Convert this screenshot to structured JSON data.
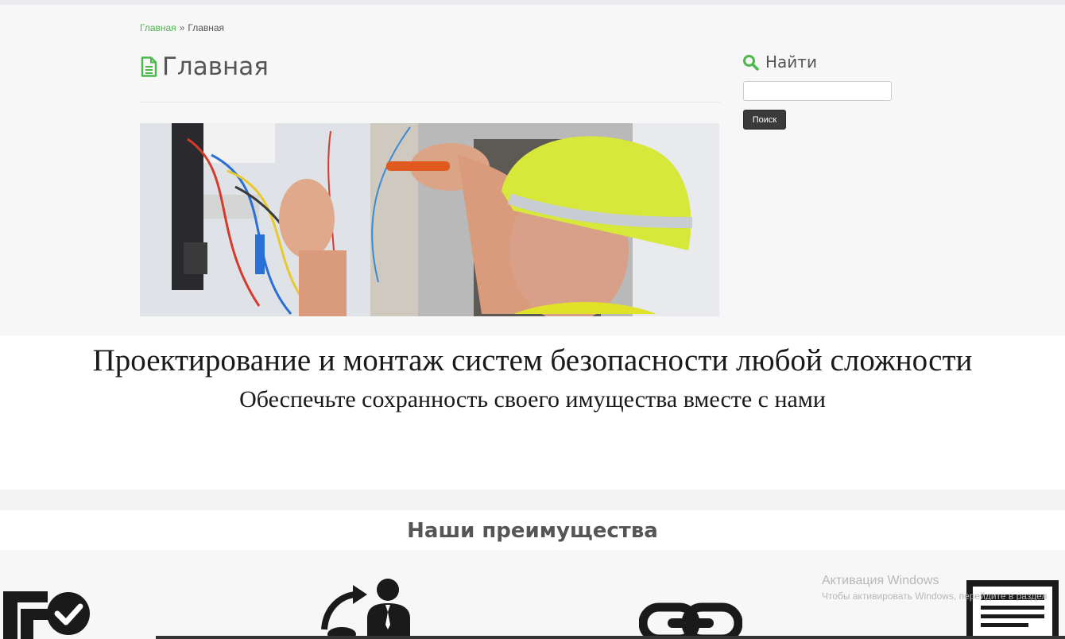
{
  "breadcrumb": {
    "home": "Главная",
    "separator": "»",
    "current": "Главная"
  },
  "page": {
    "title": "Главная"
  },
  "hero": {
    "image": "electrician-in-yellow-hardhat-wiring-panel"
  },
  "sidebar": {
    "search_title": "Найти",
    "search_value": "",
    "search_button": "Поиск"
  },
  "banner": {
    "title": "Проектирование и монтаж систем безопасности любой сложности",
    "subtitle": "Обеспечьте сохранность своего имущества вместе с нами"
  },
  "advantages": {
    "title": "Наши преимущества",
    "icons": [
      "license-check-icon",
      "person-transfer-icon",
      "chain-link-icon",
      "certificate-icon"
    ]
  },
  "watermark": {
    "line1": "Активация Windows",
    "line2": "Чтобы активировать Windows, перейдите в раздел"
  },
  "colors": {
    "accent": "#4cb84c",
    "button": "#3a3a3a",
    "text": "#555555"
  }
}
